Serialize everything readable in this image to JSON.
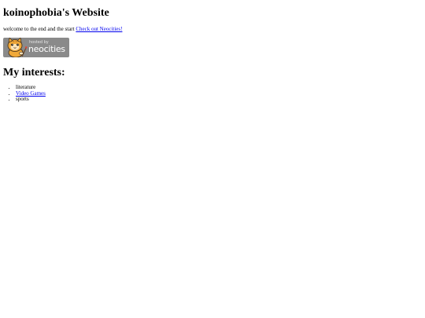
{
  "header": {
    "title": "koinophobia's Website"
  },
  "intro": {
    "text": "welcome to the end and the start",
    "link_label": "Check out Neocities!"
  },
  "badge": {
    "hosted_by": "hosted by",
    "brand": "neocities",
    "icon": "neocities-cat-icon",
    "background": "#8a8a8a"
  },
  "interests": {
    "heading": "My interests:",
    "items": [
      {
        "label": "literature",
        "is_link": false
      },
      {
        "label": "Video Games",
        "is_link": true
      },
      {
        "label": "sports",
        "is_link": false
      }
    ]
  },
  "colors": {
    "link": "#0000ee",
    "text": "#000000",
    "background": "#ffffff"
  }
}
